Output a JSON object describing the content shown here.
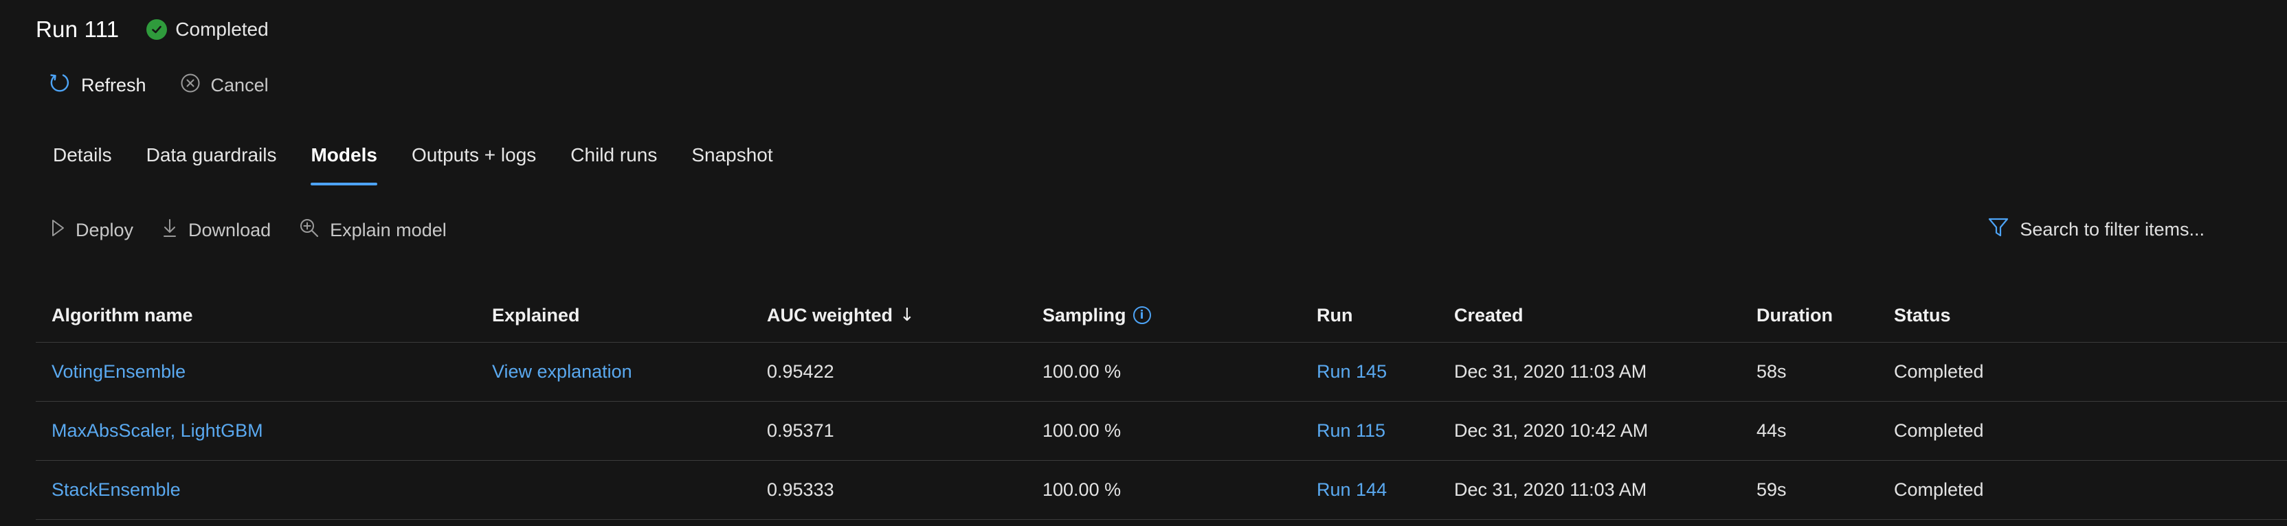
{
  "header": {
    "title": "Run 111",
    "status": "Completed"
  },
  "commands": {
    "refresh_label": "Refresh",
    "cancel_label": "Cancel"
  },
  "tabs": [
    {
      "label": "Details",
      "active": false
    },
    {
      "label": "Data guardrails",
      "active": false
    },
    {
      "label": "Models",
      "active": true
    },
    {
      "label": "Outputs + logs",
      "active": false
    },
    {
      "label": "Child runs",
      "active": false
    },
    {
      "label": "Snapshot",
      "active": false
    }
  ],
  "toolbar": {
    "deploy_label": "Deploy",
    "download_label": "Download",
    "explain_label": "Explain model",
    "search_placeholder": "Search to filter items..."
  },
  "table": {
    "columns": {
      "algorithm": "Algorithm name",
      "explained": "Explained",
      "auc": "AUC weighted",
      "sampling": "Sampling",
      "run": "Run",
      "created": "Created",
      "duration": "Duration",
      "status": "Status"
    },
    "sort_indicator": "↓",
    "info_glyph": "i",
    "rows": [
      {
        "algorithm": "VotingEnsemble",
        "explained": "View explanation",
        "auc": "0.95422",
        "sampling": "100.00 %",
        "run": "Run 145",
        "created": "Dec 31, 2020 11:03 AM",
        "duration": "58s",
        "status": "Completed"
      },
      {
        "algorithm": "MaxAbsScaler, LightGBM",
        "explained": "",
        "auc": "0.95371",
        "sampling": "100.00 %",
        "run": "Run 115",
        "created": "Dec 31, 2020 10:42 AM",
        "duration": "44s",
        "status": "Completed"
      },
      {
        "algorithm": "StackEnsemble",
        "explained": "",
        "auc": "0.95333",
        "sampling": "100.00 %",
        "run": "Run 144",
        "created": "Dec 31, 2020 11:03 AM",
        "duration": "59s",
        "status": "Completed"
      }
    ]
  },
  "colors": {
    "background": "#151515",
    "link": "#5aa9f0",
    "accent": "#4da3f5",
    "success": "#2f9b3c"
  },
  "icons": {
    "status": "check-circle-icon",
    "refresh": "refresh-icon",
    "cancel": "cancel-icon",
    "deploy": "play-icon",
    "download": "download-icon",
    "explain": "zoom-in-icon",
    "search": "filter-icon",
    "sampling_info": "info-icon"
  }
}
